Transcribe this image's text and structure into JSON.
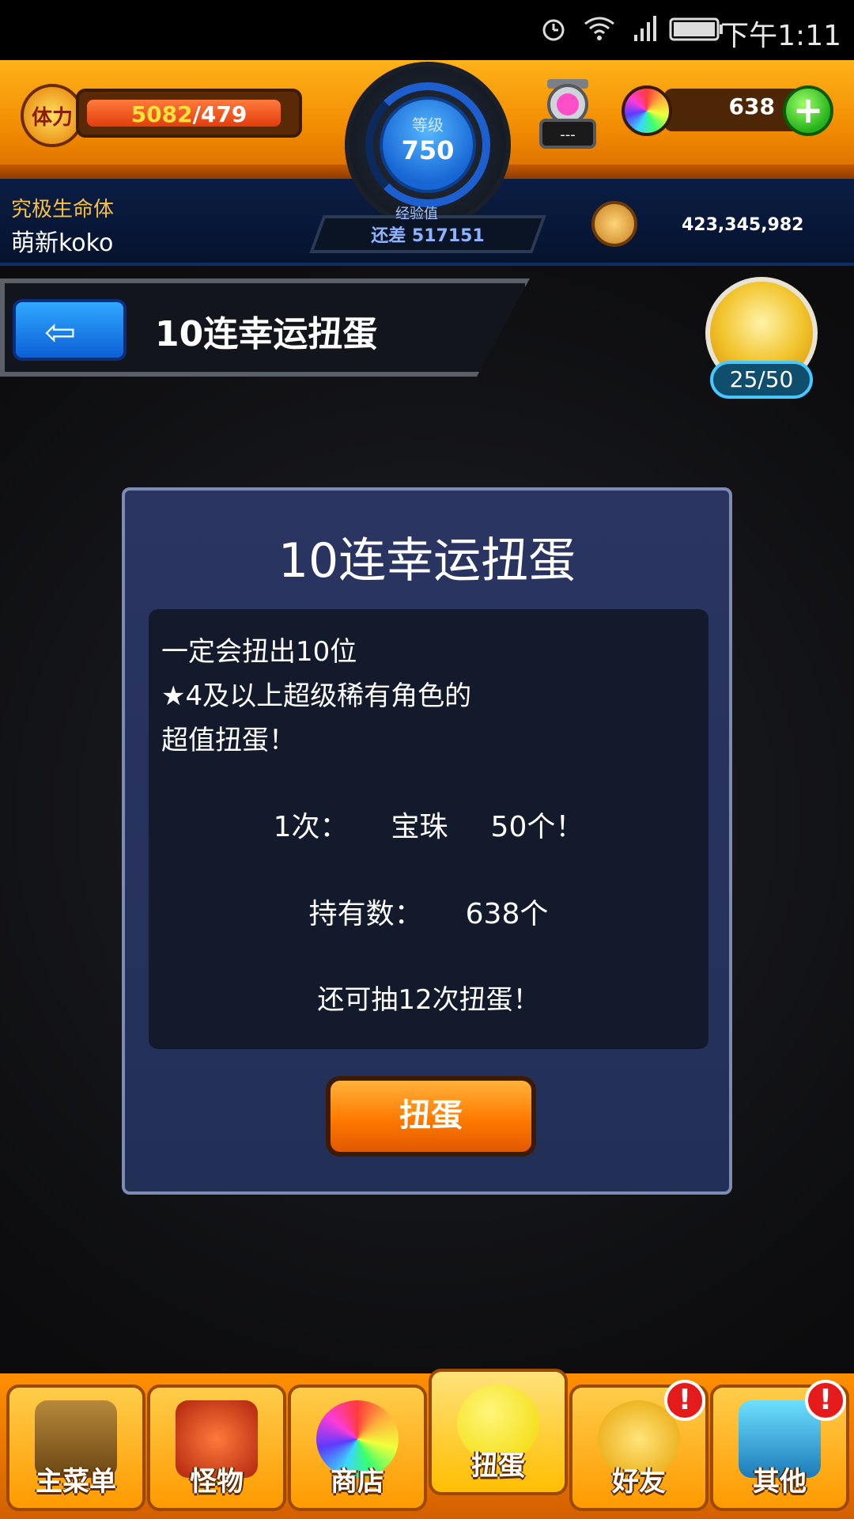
{
  "status_bar": {
    "time": "下午1:11",
    "icons": [
      "alarm-icon",
      "wifi-icon",
      "signal-icon",
      "battery-icon"
    ]
  },
  "hud": {
    "stamina_icon_label": "体力",
    "stamina_current": "5082",
    "stamina_max": "/479",
    "stamina_fill_fraction": 0.95,
    "level_label": "等级",
    "level_value": "750",
    "exp_label": "经验值",
    "exp_remaining": "还差 517151",
    "gem_count": "638",
    "player_title": "究极生命体",
    "player_name": "萌新koko",
    "coin_count": "423,345,982",
    "egg_slot_text": "---"
  },
  "page": {
    "title": "10连幸运扭蛋",
    "medal_progress": "25/50"
  },
  "dialog": {
    "title": "10连幸运扭蛋",
    "desc_line1": "一定会扭出10位",
    "desc_line2": "★4及以上超级稀有角色的",
    "desc_line3": "超值扭蛋！",
    "cost_label": "1次：",
    "cost_item": "宝珠",
    "cost_amount": "50个！",
    "have_label": "持有数：",
    "have_amount": "638个",
    "remain_text": "还可抽12次扭蛋！",
    "button_label": "扭蛋"
  },
  "nav": {
    "items": [
      {
        "label": "主菜单",
        "icon": "main-menu-icon"
      },
      {
        "label": "怪物",
        "icon": "monster-icon"
      },
      {
        "label": "商店",
        "icon": "shop-orb-icon"
      },
      {
        "label": "扭蛋",
        "icon": "gacha-egg-icon"
      },
      {
        "label": "好友",
        "icon": "friends-icon"
      },
      {
        "label": "其他",
        "icon": "other-icon"
      }
    ],
    "alert_mark": "!"
  },
  "colors": {
    "hud_orange": "#f18a00",
    "hud_blue": "#0b1d44",
    "dialog_bg": "#2a3562",
    "button_orange": "#ff7a00"
  }
}
